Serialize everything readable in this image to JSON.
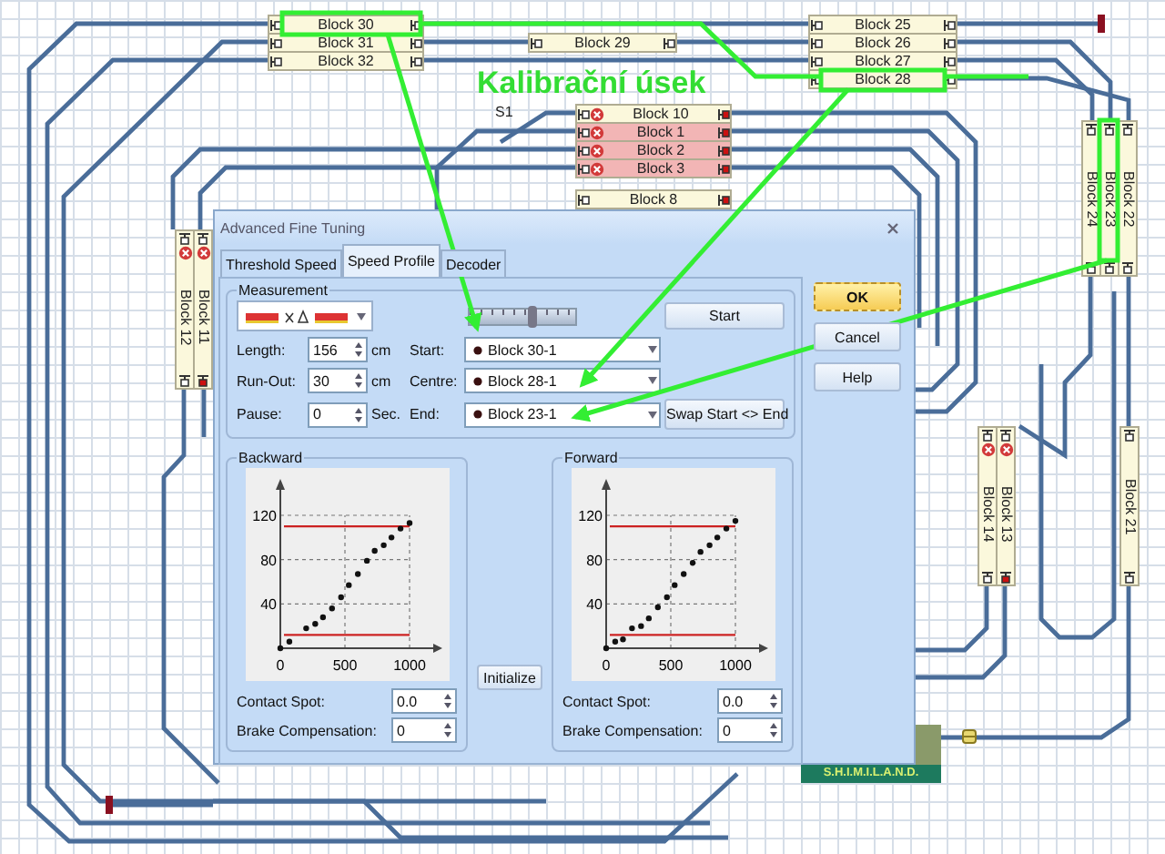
{
  "canvas": {
    "annotation": "Kalibrační úsek",
    "station_label": "S1",
    "blocks": [
      {
        "label": "Block 30",
        "highlighted": false,
        "stop": false,
        "signal_red": false
      },
      {
        "label": "Block 25",
        "highlighted": false,
        "stop": false,
        "signal_red": false
      },
      {
        "label": "Block 31",
        "highlighted": false,
        "stop": false,
        "signal_red": false
      },
      {
        "label": "Block 29",
        "highlighted": false,
        "stop": false,
        "signal_red": false
      },
      {
        "label": "Block 26",
        "highlighted": false,
        "stop": false,
        "signal_red": false
      },
      {
        "label": "Block 32",
        "highlighted": false,
        "stop": false,
        "signal_red": false
      },
      {
        "label": "Block 27",
        "highlighted": false,
        "stop": false,
        "signal_red": false
      },
      {
        "label": "Block 28",
        "highlighted": false,
        "stop": false,
        "signal_red": false
      },
      {
        "label": "Block 10",
        "highlighted": false,
        "stop": true,
        "signal_red": true
      },
      {
        "label": "Block 1",
        "highlighted": true,
        "stop": true,
        "signal_red": true
      },
      {
        "label": "Block 24",
        "highlighted": false,
        "stop": false,
        "signal_red": false
      },
      {
        "label": "Block 23",
        "highlighted": false,
        "stop": false,
        "signal_red": false
      },
      {
        "label": "Block 22",
        "highlighted": false,
        "stop": false,
        "signal_red": false
      },
      {
        "label": "Block 2",
        "highlighted": true,
        "stop": true,
        "signal_red": true
      },
      {
        "label": "Block 3",
        "highlighted": true,
        "stop": true,
        "signal_red": true
      },
      {
        "label": "Block 8",
        "highlighted": false,
        "stop": false,
        "signal_red": true
      },
      {
        "label": "Block 12",
        "highlighted": false,
        "stop": true,
        "signal_red": false
      },
      {
        "label": "Block 11",
        "highlighted": false,
        "stop": true,
        "signal_red": true
      },
      {
        "label": "Block 14",
        "highlighted": false,
        "stop": true,
        "signal_red": false
      },
      {
        "label": "Block 13",
        "highlighted": false,
        "stop": true,
        "signal_red": true
      },
      {
        "label": "Block 21",
        "highlighted": false,
        "stop": false,
        "signal_red": false
      }
    ],
    "logo": {
      "text": "S.H.I.M.I.L.A.N.D."
    }
  },
  "dialog": {
    "title": "Advanced Fine Tuning",
    "tabs": [
      {
        "label": "Threshold Speed",
        "selected": false
      },
      {
        "label": "Speed Profile",
        "selected": true
      },
      {
        "label": "Decoder",
        "selected": false
      }
    ],
    "measurement": {
      "title": "Measurement",
      "slider": {
        "level": 0.6
      },
      "start_button": "Start",
      "fields": [
        {
          "label": "Length:",
          "value": "156",
          "unit": "cm"
        },
        {
          "label": "Run-Out:",
          "value": "30",
          "unit": "cm"
        },
        {
          "label": "Pause:",
          "value": "0",
          "unit": "Sec."
        }
      ],
      "blocks": [
        {
          "label": "Start:",
          "value": "Block 30-1"
        },
        {
          "label": "Centre:",
          "value": "Block 28-1"
        },
        {
          "label": "End:",
          "value": "Block 23-1"
        }
      ],
      "swap_button": "Swap Start <> End"
    },
    "profiles": [
      {
        "title": "Backward",
        "chart_data": {
          "type": "scatter",
          "x": [
            0,
            70,
            200,
            270,
            330,
            400,
            470,
            530,
            600,
            670,
            730,
            800,
            860,
            930,
            1000
          ],
          "series": [
            {
              "color": "#111111",
              "values": [
                0,
                6,
                18,
                22,
                28,
                36,
                46,
                57,
                67,
                79,
                88,
                93,
                100,
                108,
                113
              ]
            }
          ],
          "xlim": [
            0,
            1000
          ],
          "ylim": [
            0,
            120
          ],
          "xticks": [
            0,
            500,
            1000
          ],
          "yticks": [
            40,
            80,
            120
          ],
          "grid": true,
          "ref_lines": [
            {
              "axis": "y",
              "value": 110
            },
            {
              "axis": "y",
              "value": 12
            }
          ]
        },
        "fields": [
          {
            "label": "Contact Spot:",
            "value": "0.0"
          },
          {
            "label": "Brake Compensation:",
            "value": "0"
          }
        ]
      },
      {
        "title": "Forward",
        "chart_data": {
          "type": "scatter",
          "x": [
            0,
            70,
            130,
            200,
            270,
            330,
            400,
            470,
            530,
            600,
            670,
            730,
            800,
            860,
            930,
            1000
          ],
          "series": [
            {
              "color": "#111111",
              "values": [
                0,
                6,
                8,
                18,
                20,
                27,
                37,
                46,
                57,
                67,
                77,
                87,
                93,
                100,
                108,
                115
              ]
            }
          ],
          "xlim": [
            0,
            1000
          ],
          "ylim": [
            0,
            120
          ],
          "xticks": [
            0,
            500,
            1000
          ],
          "yticks": [
            40,
            80,
            120
          ],
          "grid": true,
          "ref_lines": [
            {
              "axis": "y",
              "value": 110
            },
            {
              "axis": "y",
              "value": 12
            }
          ]
        },
        "fields": [
          {
            "label": "Contact Spot:",
            "value": "0.0"
          },
          {
            "label": "Brake Compensation:",
            "value": "0"
          }
        ]
      }
    ],
    "initialize_button": "Initialize",
    "buttons": [
      {
        "label": "OK",
        "default": true
      },
      {
        "label": "Cancel",
        "default": false
      },
      {
        "label": "Help",
        "default": false
      }
    ]
  }
}
